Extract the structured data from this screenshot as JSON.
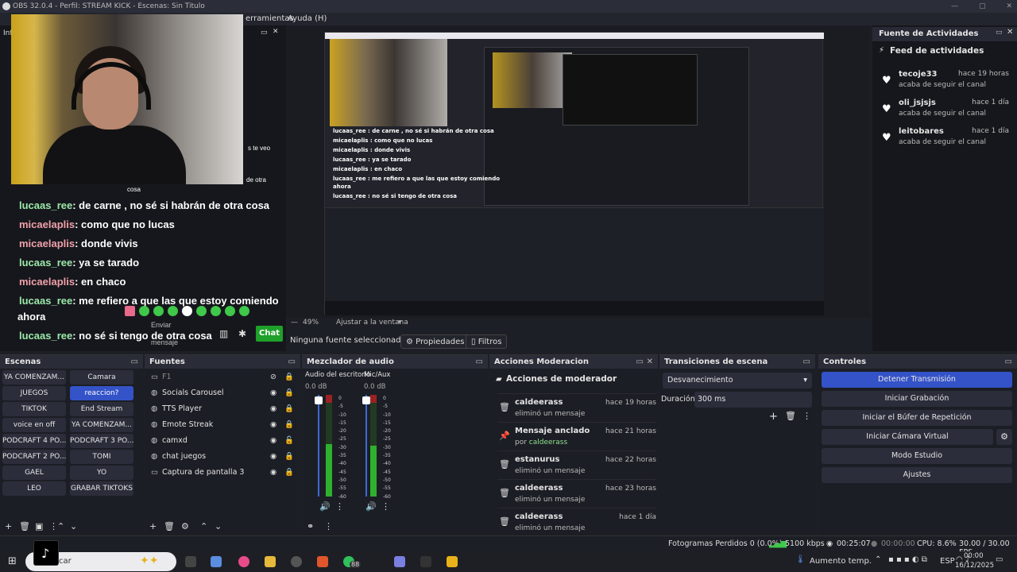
{
  "window": {
    "title": "OBS 32.0.4 - Perfil: STREAM KICK - Escenas: Sin Titulo"
  },
  "menu": {
    "tools": "erramientas",
    "help": "Ayuda (H)"
  },
  "chat": {
    "lines": [
      {
        "user": "lucaas_ree",
        "text": ": de carne , no sé si habrán de otra cosa",
        "type": "u1"
      },
      {
        "user": "micaelaplis",
        "text": ": como que no lucas",
        "type": "u2"
      },
      {
        "user": "micaelaplis",
        "text": ": donde vivis",
        "type": "u2"
      },
      {
        "user": "lucaas_ree",
        "text": ": ya se tarado",
        "type": "u1"
      },
      {
        "user": "micaelaplis",
        "text": ": en chaco",
        "type": "u2"
      },
      {
        "user": "lucaas_ree",
        "text": ": me refiero a que las que estoy comiendo",
        "type": "u1"
      },
      {
        "user": "lucaas_ree",
        "text": ": no sé si tengo de otra cosa",
        "type": "u1"
      }
    ],
    "ahora": "ahora",
    "small_cosa": "cosa",
    "small_teveo": "s te veo",
    "small_otra": "de otra",
    "enviar": "Enviar",
    "mensaje": "mensaje",
    "chat_button": "Chat"
  },
  "preview": {
    "chat_lines": [
      "lucaas_ree : de carne , no sé si habrán de otra cosa",
      "micaelaplis : como que no lucas",
      "micaelaplis : donde vivis",
      "lucaas_ree : ya se tarado",
      "micaelaplis : en chaco",
      "lucaas_ree : me refiero a que las que estoy comiendo",
      "ahora",
      "lucaas_ree : no sé si tengo de otra cosa"
    ]
  },
  "zoom": {
    "value": "49%",
    "fit": "Ajustar a la ventana"
  },
  "props": {
    "none": "Ninguna fuente seleccionad",
    "properties": "Propiedades",
    "filters": "Filtros"
  },
  "activity": {
    "title": "Fuente de Actividades",
    "feed": "Feed de actividades",
    "items": [
      {
        "name": "tecoje33",
        "desc": "acaba de seguir el canal",
        "time": "hace 19 horas"
      },
      {
        "name": "oli_jsjsjs",
        "desc": "acaba de seguir el canal",
        "time": "hace 1 día"
      },
      {
        "name": "leitobares",
        "desc": "acaba de seguir el canal",
        "time": "hace 1 día"
      }
    ]
  },
  "scenes": {
    "title": "Escenas",
    "items": [
      "YA COMENZAM...",
      "Camara",
      "JUEGOS",
      "reaccion?",
      "TIKTOK",
      "End Stream",
      "voice en off",
      "YA COMENZAM...",
      "PODCRAFT 4 PO...",
      "PODCRAFT 3 PO...",
      "PODCRAFT 2 PO...",
      "TOMI",
      "GAEL",
      "YO",
      "LEO",
      "GRABAR TIKTOKS"
    ]
  },
  "sources": {
    "title": "Fuentes",
    "items": [
      "F1",
      "Socials Carousel",
      "TTS Player",
      "Emote Streak",
      "camxd",
      "chat juegos",
      "Captura de pantalla 3"
    ]
  },
  "mixer": {
    "title": "Mezclador de audio",
    "ch1": "Audio del escritorio",
    "ch2": "Mic/Aux",
    "db1": "0.0 dB",
    "db2": "0.0 dB",
    "ticks": [
      "0",
      "-5",
      "-10",
      "-15",
      "-20",
      "-25",
      "-30",
      "-35",
      "-40",
      "-45",
      "-50",
      "-55",
      "-60"
    ]
  },
  "moderation": {
    "dock_title": "Acciones Moderacion",
    "title": "Acciones de moderador",
    "items": [
      {
        "name": "caldeerass",
        "desc": "eliminó un mensaje",
        "time": "hace 19 horas",
        "icon": "trash-icon"
      },
      {
        "name": "Mensaje anclado",
        "desc": "por",
        "by": "caldeerass",
        "time": "hace 21 horas",
        "icon": "pin-icon"
      },
      {
        "name": "estanurus",
        "desc": "eliminó un mensaje",
        "time": "hace 22 horas",
        "icon": "trash-icon"
      },
      {
        "name": "caldeerass",
        "desc": "eliminó un mensaje",
        "time": "hace 23 horas",
        "icon": "trash-icon"
      },
      {
        "name": "caldeerass",
        "desc": "eliminó un mensaje",
        "time": "hace 1 día",
        "icon": "trash-icon"
      }
    ]
  },
  "transitions": {
    "title": "Transiciones de escena",
    "type": "Desvanecimiento",
    "duration_label": "Duración",
    "duration": "300 ms"
  },
  "controls": {
    "title": "Controles",
    "stop": "Detener Transmisión",
    "record": "Iniciar Grabación",
    "replay": "Iniciar el Búfer de Repetición",
    "vcam": "Iniciar Cámara Virtual",
    "studio": "Modo Estudio",
    "settings": "Ajustes"
  },
  "status": {
    "dropped": "Fotogramas Perdidos 0 (0.0%)",
    "bitrate": "5100 kbps",
    "live": "00:25:07",
    "rec": "00:00:00",
    "cpu": "CPU: 8.6%",
    "fps": "30.00 / 30.00 FPS"
  },
  "taskbar": {
    "search": "car",
    "weather": "Aumento temp.",
    "lang": "ESP",
    "time": "00:00",
    "date": "16/12/2025",
    "badge": "88"
  },
  "colors": {
    "accent": "#3453c8",
    "bg": "#1d1f26"
  }
}
